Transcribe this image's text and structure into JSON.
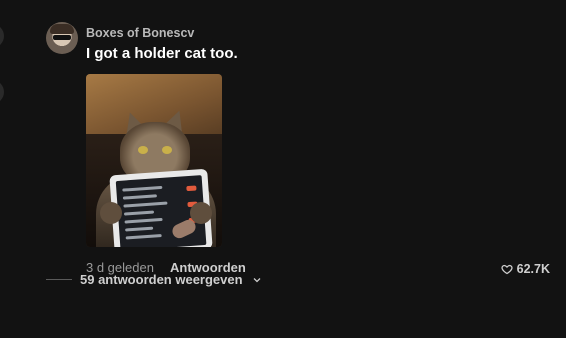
{
  "comment": {
    "username": "Boxes of Bonescv",
    "text": "I got a holder cat too.",
    "age": "3 d geleden",
    "reply_label": "Antwoorden",
    "likes": "62.7K",
    "view_replies_label": "59 antwoorden weergeven"
  },
  "icons": {
    "like": "heart-icon",
    "expand": "chevron-down-icon"
  },
  "colors": {
    "background": "#121212",
    "text_primary": "#ffffff",
    "text_secondary": "#9a9a9a"
  }
}
